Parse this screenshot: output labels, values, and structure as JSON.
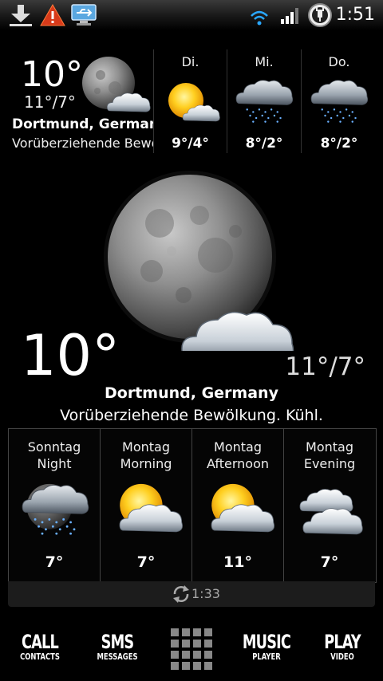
{
  "status_bar": {
    "time": "1:51",
    "icons": [
      "download-icon",
      "warning-icon",
      "usb-icon",
      "wifi-icon",
      "signal-icon",
      "battery-charging-icon"
    ]
  },
  "top_widget": {
    "temp": "10°",
    "hilo": "11°/7°",
    "city": "Dortmund, Germany",
    "condition": "Vorüberziehende Bewölkung. Kühl.",
    "forecast": [
      {
        "day": "Di.",
        "temps": "9°/4°",
        "icon": "sunny-cloud-icon"
      },
      {
        "day": "Mi.",
        "temps": "8°/2°",
        "icon": "rain-icon"
      },
      {
        "day": "Do.",
        "temps": "8°/2°",
        "icon": "rain-icon"
      }
    ]
  },
  "main": {
    "temp": "10°",
    "hilo": "11°/7°",
    "city": "Dortmund, Germany",
    "condition": "Vorüberziehende Bewölkung. Kühl."
  },
  "periods": [
    {
      "day": "Sonntag",
      "part": "Night",
      "temp": "7°",
      "icon": "night-rain-icon"
    },
    {
      "day": "Montag",
      "part": "Morning",
      "temp": "7°",
      "icon": "partly-sunny-icon"
    },
    {
      "day": "Montag",
      "part": "Afternoon",
      "temp": "11°",
      "icon": "partly-sunny-icon"
    },
    {
      "day": "Montag",
      "part": "Evening",
      "temp": "7°",
      "icon": "cloudy-icon"
    }
  ],
  "refresh": {
    "time": "1:33"
  },
  "dock": [
    {
      "big": "CALL",
      "small": "CONTACTS"
    },
    {
      "big": "SMS",
      "small": "MESSAGES"
    },
    {
      "big": "",
      "small": ""
    },
    {
      "big": "MUSIC",
      "small": "PLAYER"
    },
    {
      "big": "PLAY",
      "small": "VIDEO"
    }
  ]
}
